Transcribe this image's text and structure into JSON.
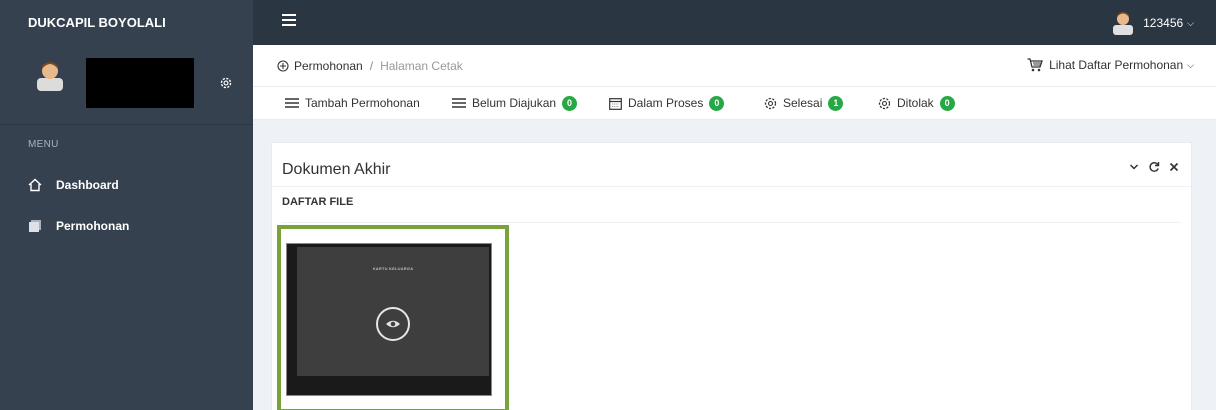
{
  "app": {
    "title": "DUKCAPIL BOYOLALI"
  },
  "topbar": {
    "username": "123456"
  },
  "sidebar": {
    "menu_label": "MENU",
    "items": [
      {
        "label": "Dashboard",
        "icon": "home-icon"
      },
      {
        "label": "Permohonan",
        "icon": "documents-icon"
      }
    ]
  },
  "breadcrumb": {
    "root": "Permohonan",
    "separator": "/",
    "current": "Halaman Cetak"
  },
  "header": {
    "list_dropdown_label": "Lihat Daftar Permohonan"
  },
  "tabs": [
    {
      "label": "Tambah Permohonan",
      "icon": "menu-lines-icon"
    },
    {
      "label": "Belum Diajukan",
      "icon": "menu-lines-icon",
      "count": "0"
    },
    {
      "label": "Dalam Proses",
      "icon": "calendar-icon",
      "count": "0"
    },
    {
      "label": "Selesai",
      "icon": "gear-icon",
      "count": "1"
    },
    {
      "label": "Ditolak",
      "icon": "gear-icon",
      "count": "0"
    }
  ],
  "portlet": {
    "title": "Dokumen Akhir",
    "subtitle": "DAFTAR FILE",
    "files": [
      {
        "caption": "KARTU KELUARGA"
      }
    ]
  },
  "colors": {
    "sidebar_bg": "#364150",
    "topbar_bg": "#2b3643",
    "badge_green": "#26a845",
    "selected_border": "#7aa23a"
  }
}
